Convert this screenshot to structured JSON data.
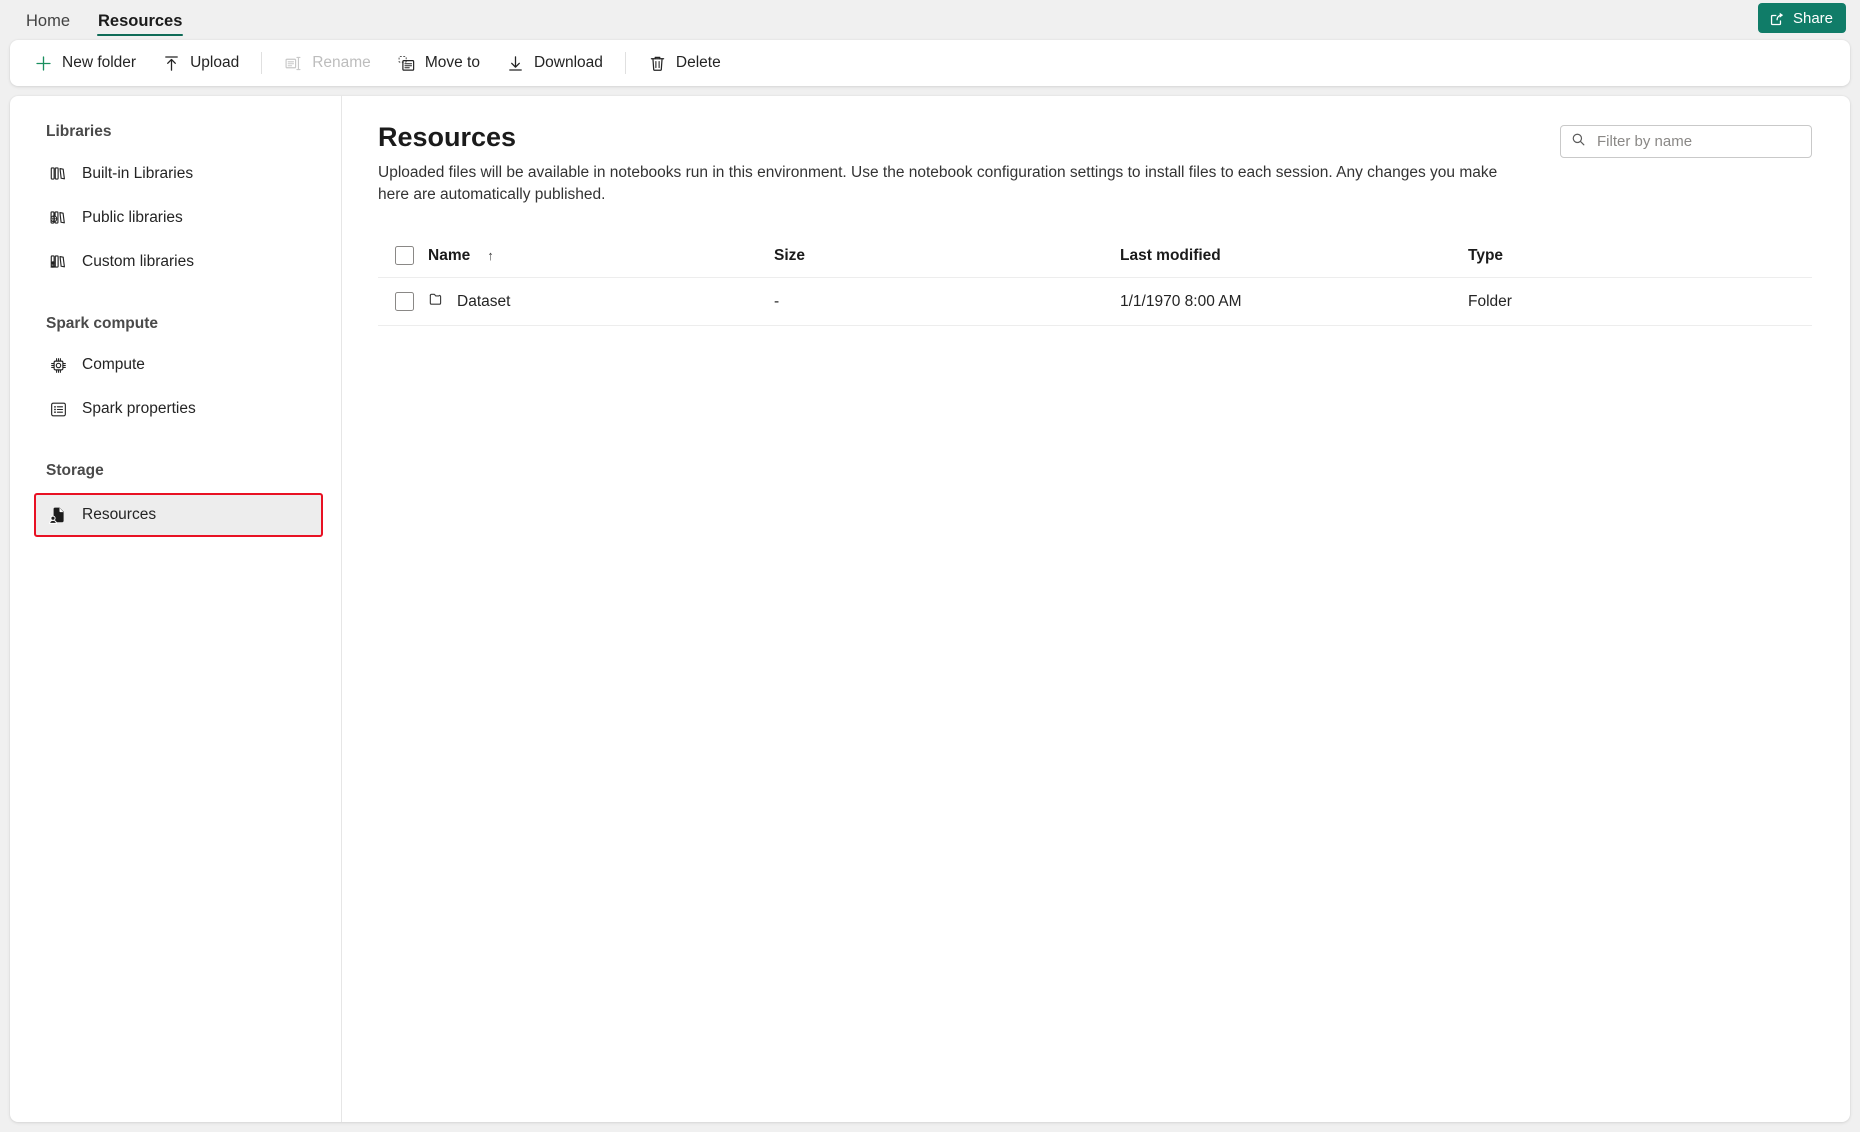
{
  "tabs": [
    {
      "label": "Home",
      "active": false,
      "name": "tab-home"
    },
    {
      "label": "Resources",
      "active": true,
      "name": "tab-resources"
    }
  ],
  "share": {
    "label": "Share",
    "icon": "share-icon",
    "color": "#107c68"
  },
  "toolbar": {
    "new_folder": "New folder",
    "upload": "Upload",
    "rename": "Rename",
    "move_to": "Move to",
    "download": "Download",
    "delete": "Delete"
  },
  "sidebar": {
    "groups": [
      {
        "title": "Libraries",
        "items": [
          {
            "label": "Built-in Libraries",
            "icon": "books-icon",
            "selected": false
          },
          {
            "label": "Public libraries",
            "icon": "public-books-icon",
            "selected": false
          },
          {
            "label": "Custom libraries",
            "icon": "custom-books-icon",
            "selected": false
          }
        ]
      },
      {
        "title": "Spark compute",
        "items": [
          {
            "label": "Compute",
            "icon": "cpu-chip-icon",
            "selected": false
          },
          {
            "label": "Spark properties",
            "icon": "list-properties-icon",
            "selected": false
          }
        ]
      },
      {
        "title": "Storage",
        "items": [
          {
            "label": "Resources",
            "icon": "resources-document-person-icon",
            "selected": true
          }
        ]
      }
    ],
    "selection_highlight_color": "#e81123"
  },
  "main": {
    "title": "Resources",
    "description": "Uploaded files will be available in notebooks run in this environment. Use the notebook configuration settings to install files to each session. Any changes you make here are automatically published.",
    "filter": {
      "placeholder": "Filter by name",
      "value": "",
      "icon": "search-icon"
    },
    "table": {
      "columns": [
        {
          "key": "name",
          "label": "Name",
          "sorted": "asc",
          "sort_glyph": "↑"
        },
        {
          "key": "size",
          "label": "Size"
        },
        {
          "key": "modified",
          "label": "Last modified"
        },
        {
          "key": "type",
          "label": "Type"
        }
      ],
      "select_all_checked": false,
      "rows": [
        {
          "checked": false,
          "icon": "folder-icon",
          "name": "Dataset",
          "size": "-",
          "modified": "1/1/1970 8:00 AM",
          "type": "Folder"
        }
      ]
    }
  }
}
